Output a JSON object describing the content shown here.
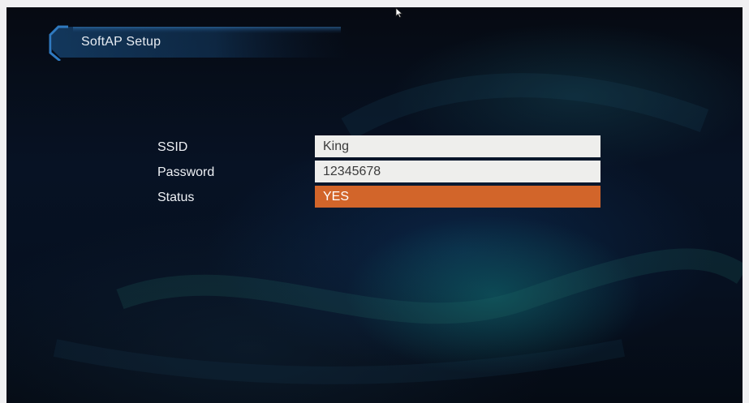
{
  "window": {
    "title": "SoftAP Setup"
  },
  "form": {
    "ssid": {
      "label": "SSID",
      "value": "King"
    },
    "password": {
      "label": "Password",
      "value": "12345678"
    },
    "status": {
      "label": "Status",
      "value": "YES"
    }
  },
  "colors": {
    "background": "#061020",
    "selected_field": "#d2652a",
    "text_field": "#eeeeec",
    "title_accent": "#2a6fb0"
  },
  "icons": {
    "cursor": "mouse-pointer-icon"
  }
}
